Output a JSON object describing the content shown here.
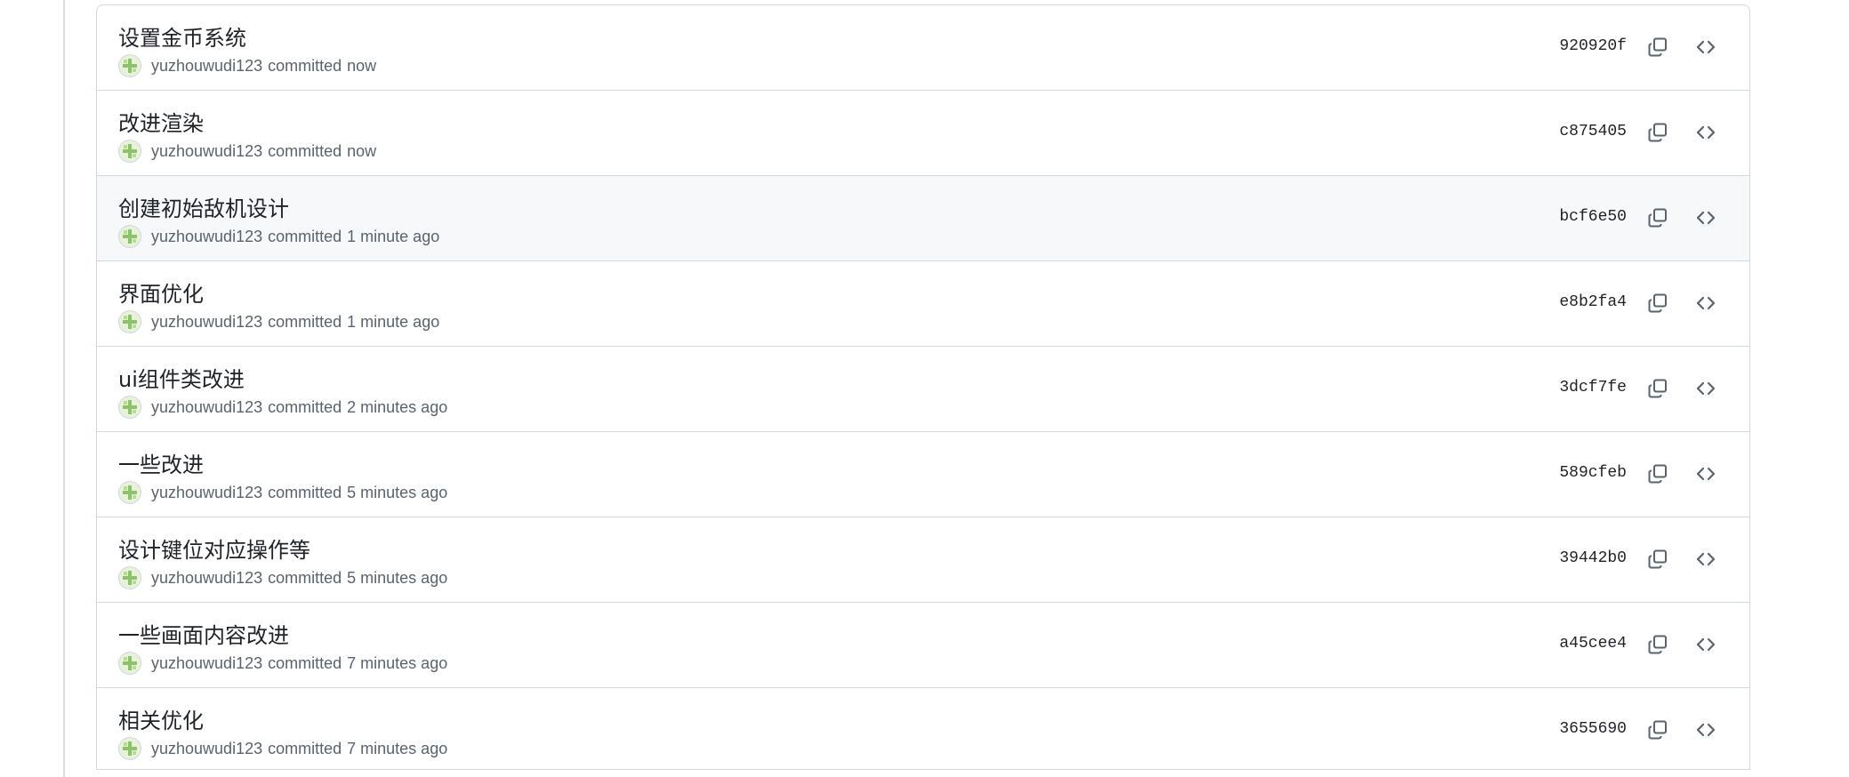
{
  "commits": [
    {
      "message": "设置金币系统",
      "author": "yuzhouwudi123",
      "action": "committed",
      "time": "now",
      "sha": "920920f"
    },
    {
      "message": "改进渲染",
      "author": "yuzhouwudi123",
      "action": "committed",
      "time": "now",
      "sha": "c875405"
    },
    {
      "message": "创建初始敌机设计",
      "author": "yuzhouwudi123",
      "action": "committed",
      "time": "1 minute ago",
      "sha": "bcf6e50"
    },
    {
      "message": "界面优化",
      "author": "yuzhouwudi123",
      "action": "committed",
      "time": "1 minute ago",
      "sha": "e8b2fa4"
    },
    {
      "message": "ui组件类改进",
      "author": "yuzhouwudi123",
      "action": "committed",
      "time": "2 minutes ago",
      "sha": "3dcf7fe"
    },
    {
      "message": "一些改进",
      "author": "yuzhouwudi123",
      "action": "committed",
      "time": "5 minutes ago",
      "sha": "589cfeb"
    },
    {
      "message": "设计键位对应操作等",
      "author": "yuzhouwudi123",
      "action": "committed",
      "time": "5 minutes ago",
      "sha": "39442b0"
    },
    {
      "message": "一些画面内容改进",
      "author": "yuzhouwudi123",
      "action": "committed",
      "time": "7 minutes ago",
      "sha": "a45cee4"
    },
    {
      "message": "相关优化",
      "author": "yuzhouwudi123",
      "action": "committed",
      "time": "7 minutes ago",
      "sha": "3655690"
    }
  ],
  "icons": {
    "avatar": "avatar-icon",
    "copy": "copy-icon",
    "browse": "code-brackets-icon"
  },
  "colors": {
    "text": "#1f2328",
    "muted": "#59636e",
    "border": "#d1d9e0",
    "hover_row": "#f6f8fa"
  }
}
